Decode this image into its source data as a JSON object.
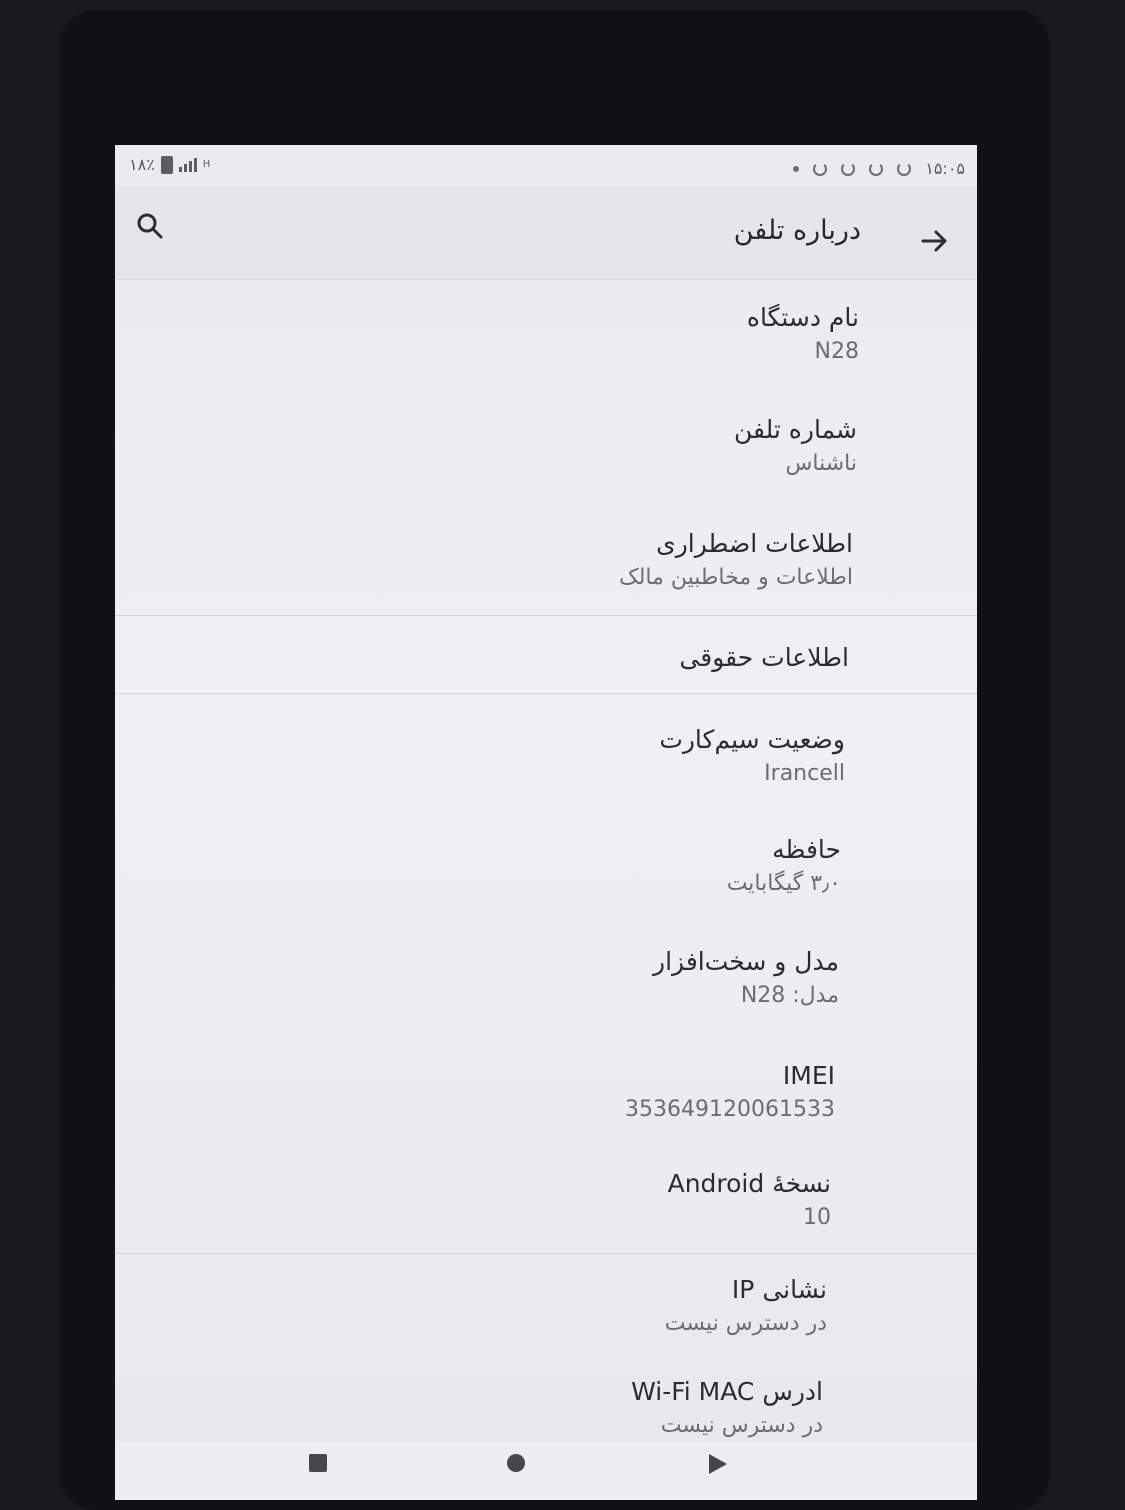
{
  "status_bar": {
    "battery_text": "۱۸٪",
    "network_text": "H",
    "time": "۱۵:۰۵"
  },
  "toolbar": {
    "title": "درباره تلفن",
    "search_icon": "search-icon",
    "back_icon": "arrow-right-icon"
  },
  "items": [
    {
      "label": "نام دستگاه",
      "sub": "N28"
    },
    {
      "label": "شماره تلفن",
      "sub": "ناشناس"
    },
    {
      "label": "اطلاعات اضطراری",
      "sub": "اطلاعات و مخاطبین مالک"
    },
    {
      "label": "اطلاعات حقوقی",
      "sub": ""
    },
    {
      "label": "وضعیت سیم‌کارت",
      "sub": "Irancell"
    },
    {
      "label": "حافظه",
      "sub": "۳٫۰ گیگابایت"
    },
    {
      "label": "مدل و سخت‌افزار",
      "sub": "مدل: N28"
    },
    {
      "label": "IMEI",
      "sub": "353649120061533"
    },
    {
      "label": "نسخهٔ Android",
      "sub": "10"
    },
    {
      "label": "نشانی IP",
      "sub": "در دسترس نیست"
    },
    {
      "label": "ادرس Wi-Fi MAC",
      "sub": "در دسترس نیست"
    }
  ],
  "nav": {
    "recent_icon": "square-recent-icon",
    "home_icon": "circle-home-icon",
    "back_icon": "triangle-back-icon"
  }
}
